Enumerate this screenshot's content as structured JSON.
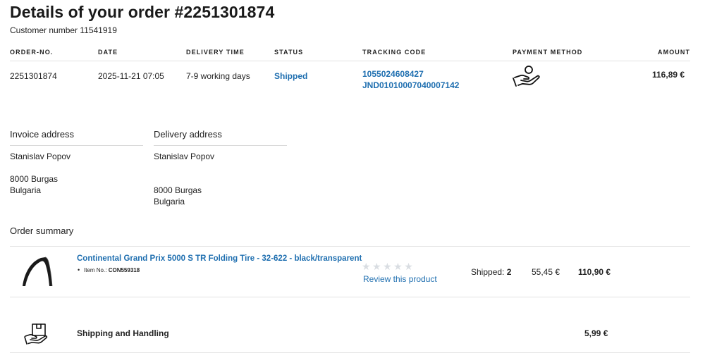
{
  "header": {
    "title": "Details of your order #2251301874",
    "customer_number": "Customer number 11541919"
  },
  "order_table": {
    "columns": {
      "order_no": "ORDER-NO.",
      "date": "DATE",
      "delivery_time": "DELIVERY TIME",
      "status": "STATUS",
      "tracking_code": "TRACKING CODE",
      "payment_method": "PAYMENT METHOD",
      "amount": "AMOUNT"
    },
    "row": {
      "order_no": "2251301874",
      "date": "2025-11-21 07:05",
      "delivery_time": "7-9 working days",
      "status": "Shipped",
      "tracking_codes": [
        "1055024608427",
        "JND01010007040007142"
      ],
      "payment_icon": "hand-coin-icon",
      "amount": "116,89 €"
    }
  },
  "addresses": {
    "invoice": {
      "title": "Invoice address",
      "name": "Stanislav Popov",
      "city": "8000 Burgas",
      "country": "Bulgaria"
    },
    "delivery": {
      "title": "Delivery address",
      "name": "Stanislav Popov",
      "city": "8000 Burgas",
      "country": "Bulgaria"
    }
  },
  "summary": {
    "title": "Order summary",
    "item": {
      "name": "Continental Grand Prix 5000 S TR Folding Tire - 32-622 - black/transparent",
      "item_no_label": "Item No.:",
      "item_no": "CON559318",
      "rating_stars": "★★★★★",
      "rating_value": 0,
      "review_link": "Review this product",
      "shipped_label": "Shipped:",
      "shipped_qty": "2",
      "unit_price": "55,45 €",
      "total": "110,90 €",
      "image_icon": "tire-icon"
    },
    "shipping": {
      "label": "Shipping and Handling",
      "price": "5,99 €",
      "icon": "package-icon"
    }
  },
  "colors": {
    "link": "#1f6fb0",
    "text": "#222222",
    "divider": "#e2e2e2",
    "star_empty": "#d9dde2"
  }
}
